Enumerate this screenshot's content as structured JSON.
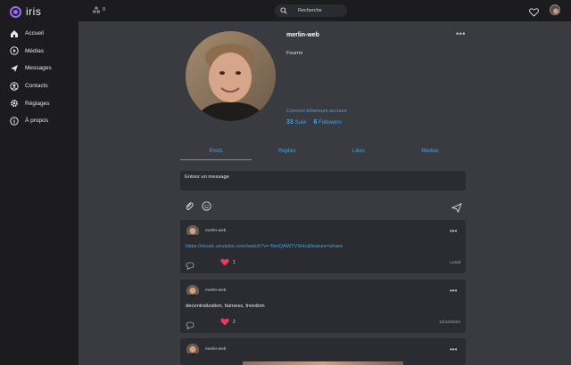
{
  "app": {
    "name": "iris",
    "accent": "#9b6bff",
    "link_color": "#3ea6e8"
  },
  "sidebar": {
    "items": [
      {
        "label": "Accueil",
        "icon": "home-icon"
      },
      {
        "label": "Médias",
        "icon": "play-icon"
      },
      {
        "label": "Messages",
        "icon": "send-icon"
      },
      {
        "label": "Contacts",
        "icon": "contacts-icon"
      },
      {
        "label": "Réglages",
        "icon": "gear-icon"
      },
      {
        "label": "À propos",
        "icon": "info-icon"
      }
    ]
  },
  "topbar": {
    "peers_count": "0",
    "search_placeholder": "Recherche"
  },
  "profile": {
    "name": "merlin-web",
    "bio": "Fourmi",
    "eth_link": "Connect Ethereum account",
    "following_count": "33",
    "following_label": "Suivi",
    "followers_count": "6",
    "followers_label": "Followers"
  },
  "tabs": [
    {
      "label": "Posts",
      "active": true
    },
    {
      "label": "Replies",
      "active": false
    },
    {
      "label": "Likes",
      "active": false
    },
    {
      "label": "Médias",
      "active": false
    }
  ],
  "compose": {
    "placeholder": "Entrez un message"
  },
  "posts": [
    {
      "author": "merlin-web",
      "text": "https://music.youtube.com/watch?v=-NmQAW7VSHc&feature=share",
      "is_link": true,
      "likes": "1",
      "time": "Lundi"
    },
    {
      "author": "merlin-web",
      "text": "decentralization, fairness, freedom",
      "is_link": false,
      "likes": "2",
      "time": "12/10/2022"
    },
    {
      "author": "merlin-web"
    }
  ]
}
